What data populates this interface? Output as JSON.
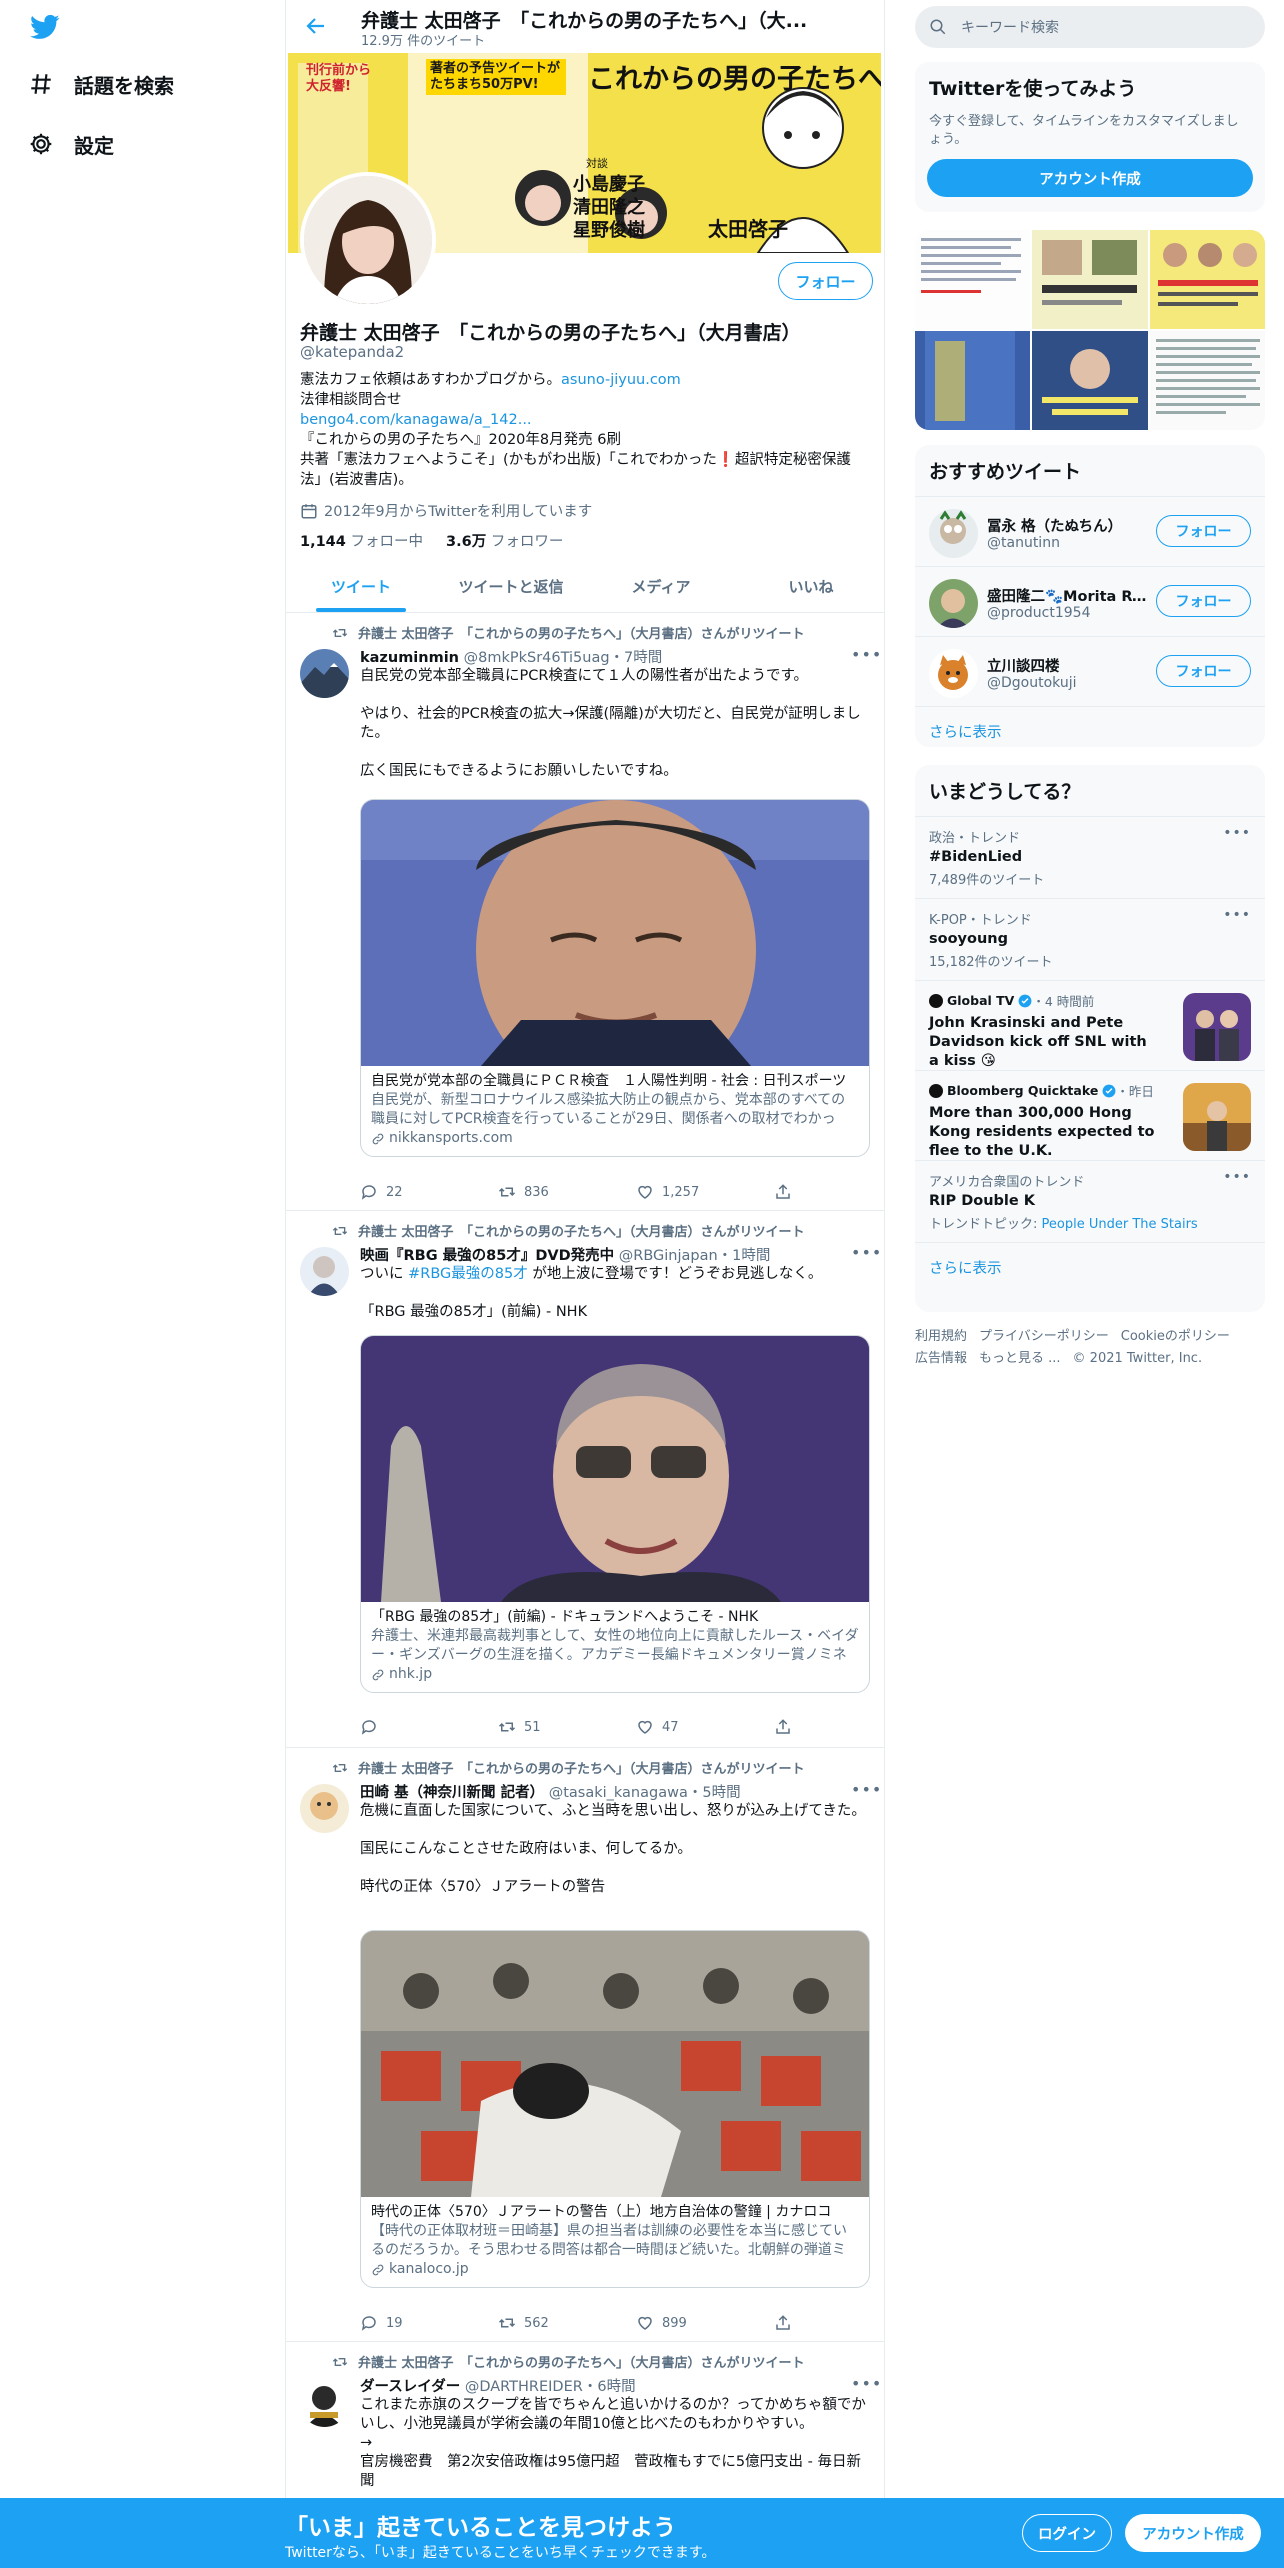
{
  "nav": {
    "explore": "話題を検索",
    "settings": "設定"
  },
  "header": {
    "name": "弁護士 太田啓子　「これからの男の子たちへ」（大...",
    "tweet_count": "12.9万 件のツイート"
  },
  "profile": {
    "follow_label": "フォロー",
    "name": "弁護士 太田啓子　「これからの男の子たちへ」（大月書店）",
    "handle": "@katepanda2",
    "bio_line1": "憲法カフェ依頼はあすわかブログから。",
    "bio_link1": "asuno-jiyuu.com",
    "bio_line2": "法律相談問合せ",
    "bio_link2": "bengo4.com/kanagawa/a_142...",
    "bio_line3": "『これからの男の子たちへ』2020年8月発売 6刷",
    "bio_line4": "共著「憲法カフェへようこそ」(かもがわ出版)「これでわかった❗️超訳特定秘密保護法」(岩波書店)。",
    "joined": "2012年9月からTwitterを利用しています",
    "following_count": "1,144",
    "following_label": "フォロー中",
    "followers_count": "3.6万",
    "followers_label": "フォロワー"
  },
  "banner": {
    "title": "これからの男の子たちへ",
    "badge": "刊行前から大反響!",
    "author": "太田啓子",
    "dialog_label": "対談",
    "names": [
      "小島慶子",
      "清田隆之",
      "星野俊樹"
    ],
    "promo": "著者の予告ツイートがたちまち50万PV!"
  },
  "tabs": [
    "ツイート",
    "ツイートと返信",
    "メディア",
    "いいね"
  ],
  "tweets": [
    {
      "rt_label": "弁護士 太田啓子　「これからの男の子たちへ」（大月書店）さんがリツイート",
      "name": "kazuminmin",
      "meta": "@8mkPkSr46Ti5uag・7時間",
      "text": "自民党の党本部全職員にPCR検査にて１人の陽性者が出たようです。\n\nやはり、社会的PCR検査の拡大→保護(隔離)が大切だと、自民党が証明しました。\n\n広く国民にもできるようにお願いしたいですね。",
      "card_title": "自民党が党本部の全職員にＰＣＲ検査　１人陽性判明 - 社会 : 日刊スポーツ",
      "card_desc": "自民党が、新型コロナウイルス感染拡大防止の観点から、党本部のすべての職員に対してPCR検査を行っていることが29日、関係者への取材でわかった。",
      "card_domain": "nikkansports.com",
      "replies": "22",
      "retweets": "836",
      "likes": "1,257"
    },
    {
      "rt_label": "弁護士 太田啓子　「これからの男の子たちへ」（大月書店）さんがリツイート",
      "name": "映画『RBG 最強の85才』DVD発売中",
      "meta": "@RBGinjapan・1時間",
      "text_pre": "ついに ",
      "text_tag": "#RBG最強の85才",
      "text_post": " が地上波に登場です！どうぞお見逃しなく。\n\n「RBG 最強の85才」(前編) - NHK",
      "card_title": "「RBG 最強の85才」(前編) - ドキュランドへようこそ - NHK",
      "card_desc": "弁護士、米連邦最高裁判事として、女性の地位向上に貢献したルース・ベイダー・ギンズバーグの生涯を描く。アカデミー長編ドキュメンタリー賞ノミネート作品。",
      "card_domain": "nhk.jp",
      "replies": "",
      "retweets": "51",
      "likes": "47"
    },
    {
      "rt_label": "弁護士 太田啓子　「これからの男の子たちへ」（大月書店）さんがリツイート",
      "name": "田崎 基（神奈川新聞 記者）",
      "meta": "@tasaki_kanagawa・5時間",
      "text": "危機に直面した国家について、ふと当時を思い出し、怒りが込み上げてきた。\n\n国民にこんなことさせた政府はいま、何してるか。\n\n時代の正体〈570〉Ｊアラートの警告",
      "card_title": "時代の正体〈570〉Ｊアラートの警告（上）地方自治体の警鐘 | カナロコ",
      "card_desc": "【時代の正体取材班＝田崎基】県の担当者は訓練の必要性を本当に感じているのだろうか。そう思わせる問答は都合一時間ほど続いた。北朝鮮の弾道ミサイル発射を想定した訓練。",
      "card_domain": "kanaloco.jp",
      "replies": "19",
      "retweets": "562",
      "likes": "899"
    },
    {
      "rt_label": "弁護士 太田啓子　「これからの男の子たちへ」（大月書店）さんがリツイート",
      "name": "ダースレイダー",
      "meta": "@DARTHREIDER・6時間",
      "text": "これまた赤旗のスクープを皆でちゃんと追いかけるのか？ってかめちゃ額でかいし、小池晃議員が学術会議の年間10億と比べたのもわかりやすい。\n→\n官房機密費　第2次安倍政権は95億円超　菅政権もすでに5億円支出 - 毎日新聞"
    }
  ],
  "search": {
    "placeholder": "キーワード検索"
  },
  "signup": {
    "title": "Twitterを使ってみよう",
    "desc": "今すぐ登録して、タイムラインをカスタマイズしましょう。",
    "button": "アカウント作成"
  },
  "who_to_follow": {
    "title": "おすすめツイート",
    "follow_label": "フォロー",
    "users": [
      {
        "name": "冨永 格（たぬちん）",
        "handle": "@tanutinn"
      },
      {
        "name": "盛田隆二🐾Morita Ryuji",
        "handle": "@product1954"
      },
      {
        "name": "立川談四楼",
        "handle": "@Dgoutokuji"
      }
    ],
    "more": "さらに表示"
  },
  "trends": {
    "title": "いまどうしてる？",
    "items": [
      {
        "context": "政治・トレンド",
        "name": "#BidenLied",
        "count": "7,489件のツイート"
      },
      {
        "context": "K-POP・トレンド",
        "name": "sooyoung",
        "count": "15,182件のツイート"
      }
    ],
    "news": [
      {
        "source": "Global TV",
        "time": "・4 時間前",
        "headline": "John Krasinski and Pete Davidson kick off SNL with a kiss 😘"
      },
      {
        "source": "Bloomberg Quicktake",
        "time": "・昨日",
        "headline": "More than 300,000 Hong Kong residents expected to flee to the U.K."
      }
    ],
    "last": {
      "context": "アメリカ合衆国のトレンド",
      "name": "RIP Double K",
      "topic_label": "トレンドトピック:",
      "topic": "People Under The Stairs"
    },
    "more": "さらに表示"
  },
  "footer": {
    "links": [
      "利用規約",
      "プライバシーポリシー",
      "Cookieのポリシー",
      "広告情報",
      "もっと見る ..."
    ],
    "copyright": "© 2021 Twitter, Inc."
  },
  "bottombar": {
    "title": "「いま」起きていることを見つけよう",
    "subtitle": "Twitterなら、「いま」起きていることをいち早くチェックできます。",
    "login": "ログイン",
    "signup": "アカウント作成"
  },
  "colors": {
    "accent": "#1da1f2",
    "link": "#1b95e0",
    "muted": "#5b7083",
    "banner": "#f3e04a"
  }
}
